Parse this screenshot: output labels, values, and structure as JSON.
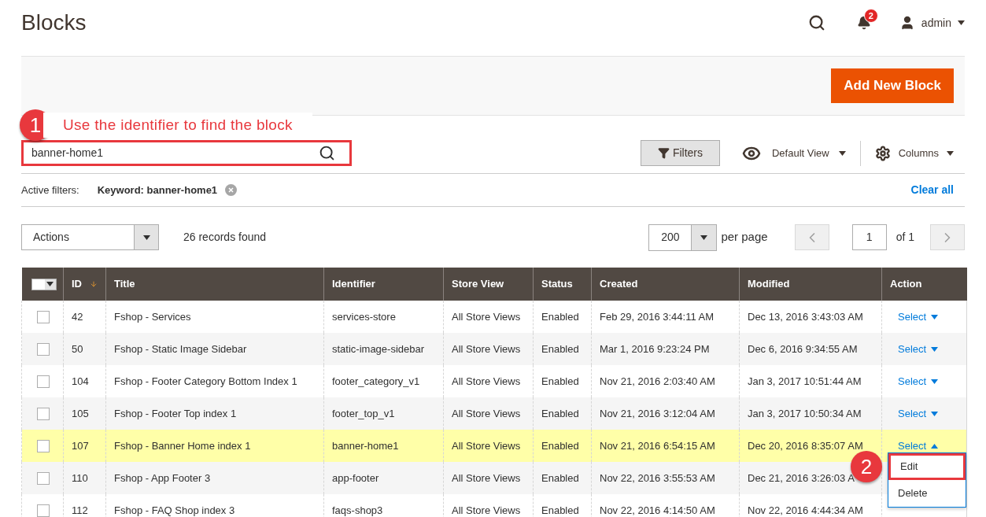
{
  "page_title": "Blocks",
  "header": {
    "notifications_count": "2",
    "user": "admin"
  },
  "add_button": "Add New Block",
  "annotations": [
    {
      "number": "1",
      "text": "Use the identifier to find the block"
    },
    {
      "number": "2"
    }
  ],
  "search": {
    "value": "banner-home1",
    "outlined": true
  },
  "toolbar": {
    "filters": "Filters",
    "view": "Default View",
    "columns": "Columns"
  },
  "active_filters": {
    "label": "Active filters:",
    "filter": "Keyword: banner-home1",
    "clear": "Clear all"
  },
  "actions_select": "Actions",
  "records": "26 records found",
  "pagination": {
    "per_page_value": "200",
    "per_page_label": "per page",
    "page": "1",
    "of": "of 1"
  },
  "table": {
    "select_all_checked": false,
    "columns": [
      "ID",
      "Title",
      "Identifier",
      "Store View",
      "Status",
      "Created",
      "Modified",
      "Action"
    ],
    "rows": [
      {
        "checked": false,
        "selected": false,
        "cells": [
          "42",
          "Fshop - Services",
          "services-store",
          "All Store Views",
          "Enabled",
          "Feb 29, 2016 3:44:11 AM",
          "Dec 13, 2016 3:43:03 AM"
        ],
        "action": "Select",
        "expanded": false
      },
      {
        "checked": false,
        "selected": false,
        "cells": [
          "50",
          "Fshop - Static Image Sidebar",
          "static-image-sidebar",
          "All Store Views",
          "Enabled",
          "Mar 1, 2016 9:23:24 PM",
          "Dec 6, 2016 9:34:55 AM"
        ],
        "action": "Select",
        "expanded": false
      },
      {
        "checked": false,
        "selected": false,
        "cells": [
          "104",
          "Fshop - Footer Category Bottom Index 1",
          "footer_category_v1",
          "All Store Views",
          "Enabled",
          "Nov 21, 2016 2:03:40 AM",
          "Jan 3, 2017 10:51:44 AM"
        ],
        "action": "Select",
        "expanded": false
      },
      {
        "checked": false,
        "selected": false,
        "cells": [
          "105",
          "Fshop - Footer Top index 1",
          "footer_top_v1",
          "All Store Views",
          "Enabled",
          "Nov 21, 2016 3:12:04 AM",
          "Jan 3, 2017 10:50:34 AM"
        ],
        "action": "Select",
        "expanded": false
      },
      {
        "checked": false,
        "selected": true,
        "cells": [
          "107",
          "Fshop - Banner Home index 1",
          "banner-home1",
          "All Store Views",
          "Enabled",
          "Nov 21, 2016 6:54:15 AM",
          "Dec 20, 2016 8:35:07 AM"
        ],
        "action": "Select",
        "expanded": true,
        "menu": [
          {
            "label": "Edit",
            "outlined": true
          },
          {
            "label": "Delete",
            "outlined": false
          }
        ]
      },
      {
        "checked": false,
        "selected": false,
        "cells": [
          "110",
          "Fshop - App Footer 3",
          "app-footer",
          "All Store Views",
          "Enabled",
          "Nov 22, 2016 3:55:53 AM",
          "Dec 21, 2016 3:26:03 A"
        ]
      },
      {
        "checked": false,
        "selected": false,
        "cells": [
          "112",
          "Fshop - FAQ Shop index 3",
          "faqs-shop3",
          "All Store Views",
          "Enabled",
          "Nov 22, 2016 4:14:50 AM",
          "Nov 22, 2016 4:44:34 AM"
        ]
      }
    ]
  }
}
